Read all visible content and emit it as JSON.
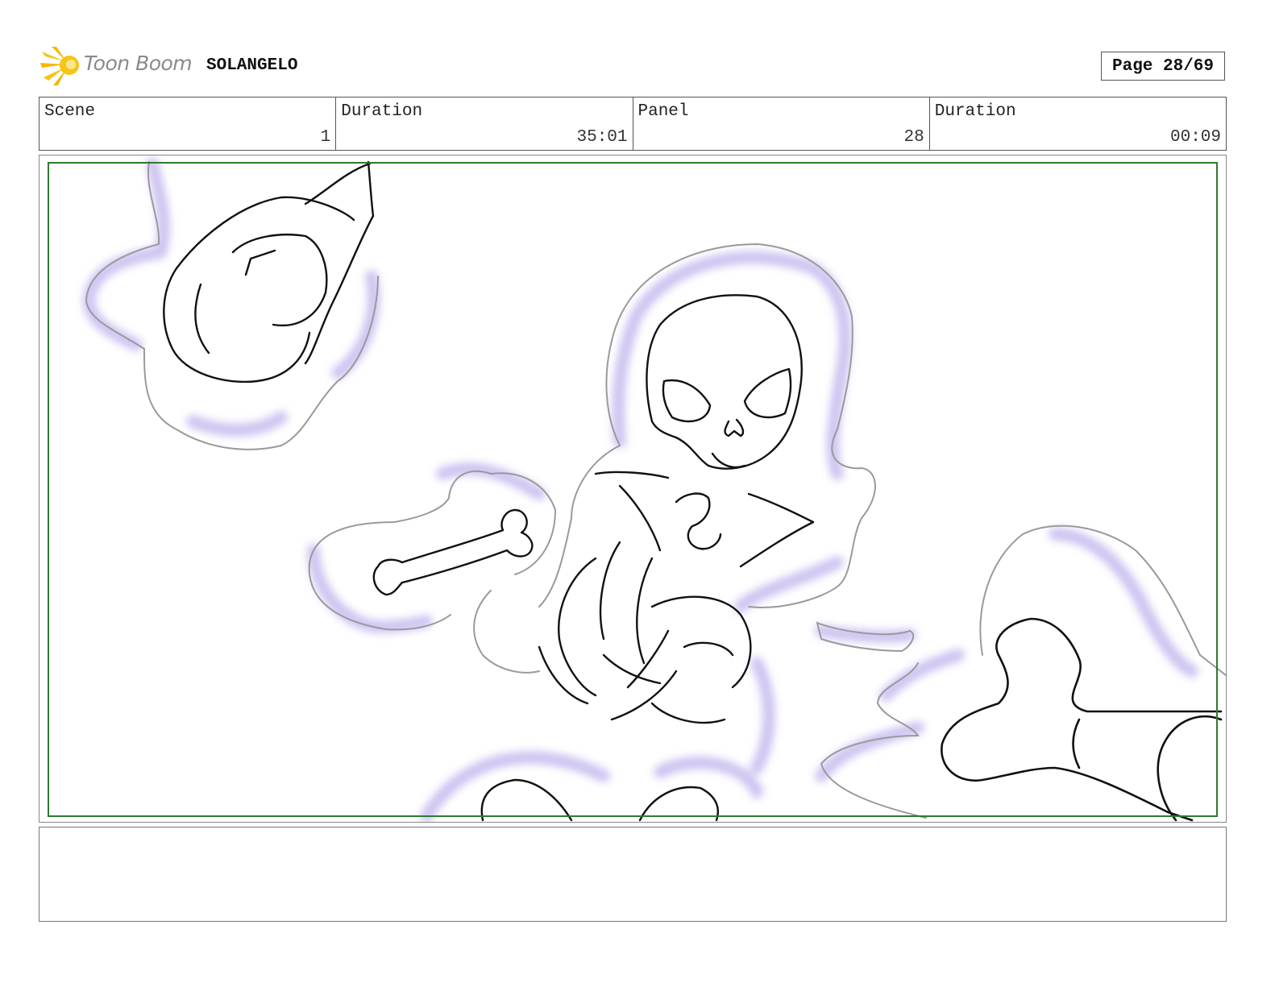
{
  "header": {
    "logo_text": "Toon Boom",
    "project_title": "SOLANGELO",
    "page_label": "Page 28/69"
  },
  "info": {
    "scene_label": "Scene",
    "scene_value": "1",
    "scene_duration_label": "Duration",
    "scene_duration_value": "35:01",
    "panel_label": "Panel",
    "panel_value": "28",
    "panel_duration_label": "Duration",
    "panel_duration_value": "00:09"
  },
  "colors": {
    "safe_frame": "#2e7a2e",
    "glow": "#c9bdf0",
    "logo_yellow": "#f5c518"
  },
  "notes": {
    "text": ""
  }
}
